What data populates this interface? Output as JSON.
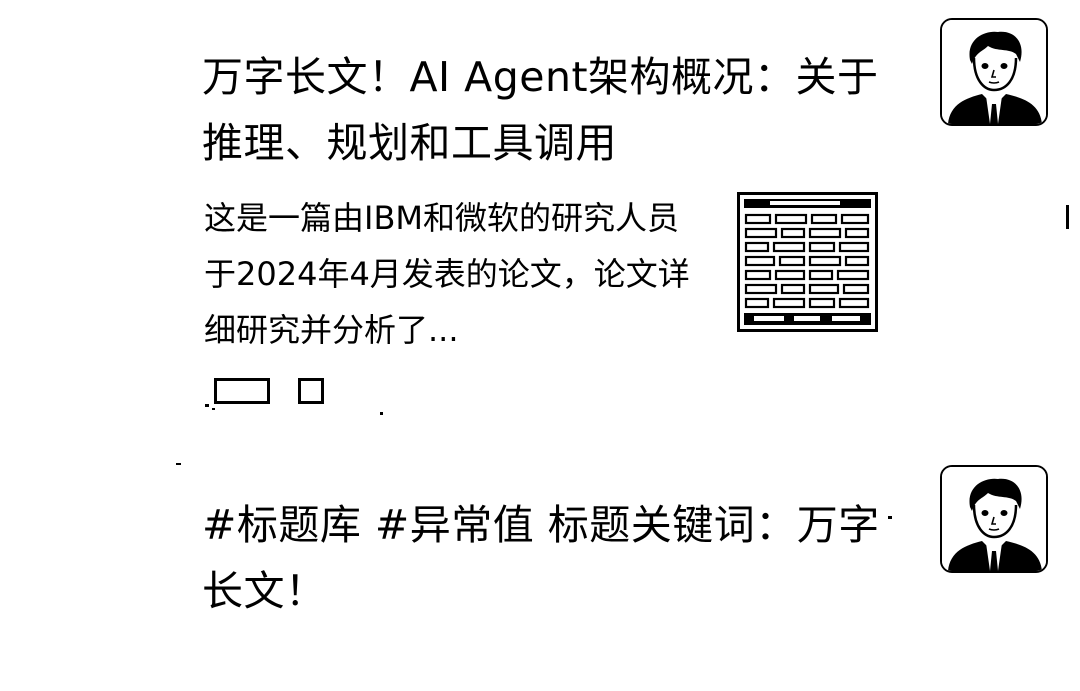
{
  "feed": {
    "items": [
      {
        "title": "万字长文！AI Agent架构概况：关于推理、规划和工具调用",
        "summary": "这是一篇由IBM和微软的研究人员于2024年4月发表的论文，论文详细研究并分析了...",
        "avatar_icon": "author-avatar-icon",
        "thumbnail_icon": "architecture-diagram-thumbnail",
        "actions": [
          "comment-icon",
          "share-icon"
        ]
      },
      {
        "title": "#标题库 #异常值 标题关键词：万字长文！",
        "avatar_icon": "author-avatar-icon"
      }
    ]
  },
  "colors": {
    "text": "#000000",
    "background": "#ffffff"
  }
}
